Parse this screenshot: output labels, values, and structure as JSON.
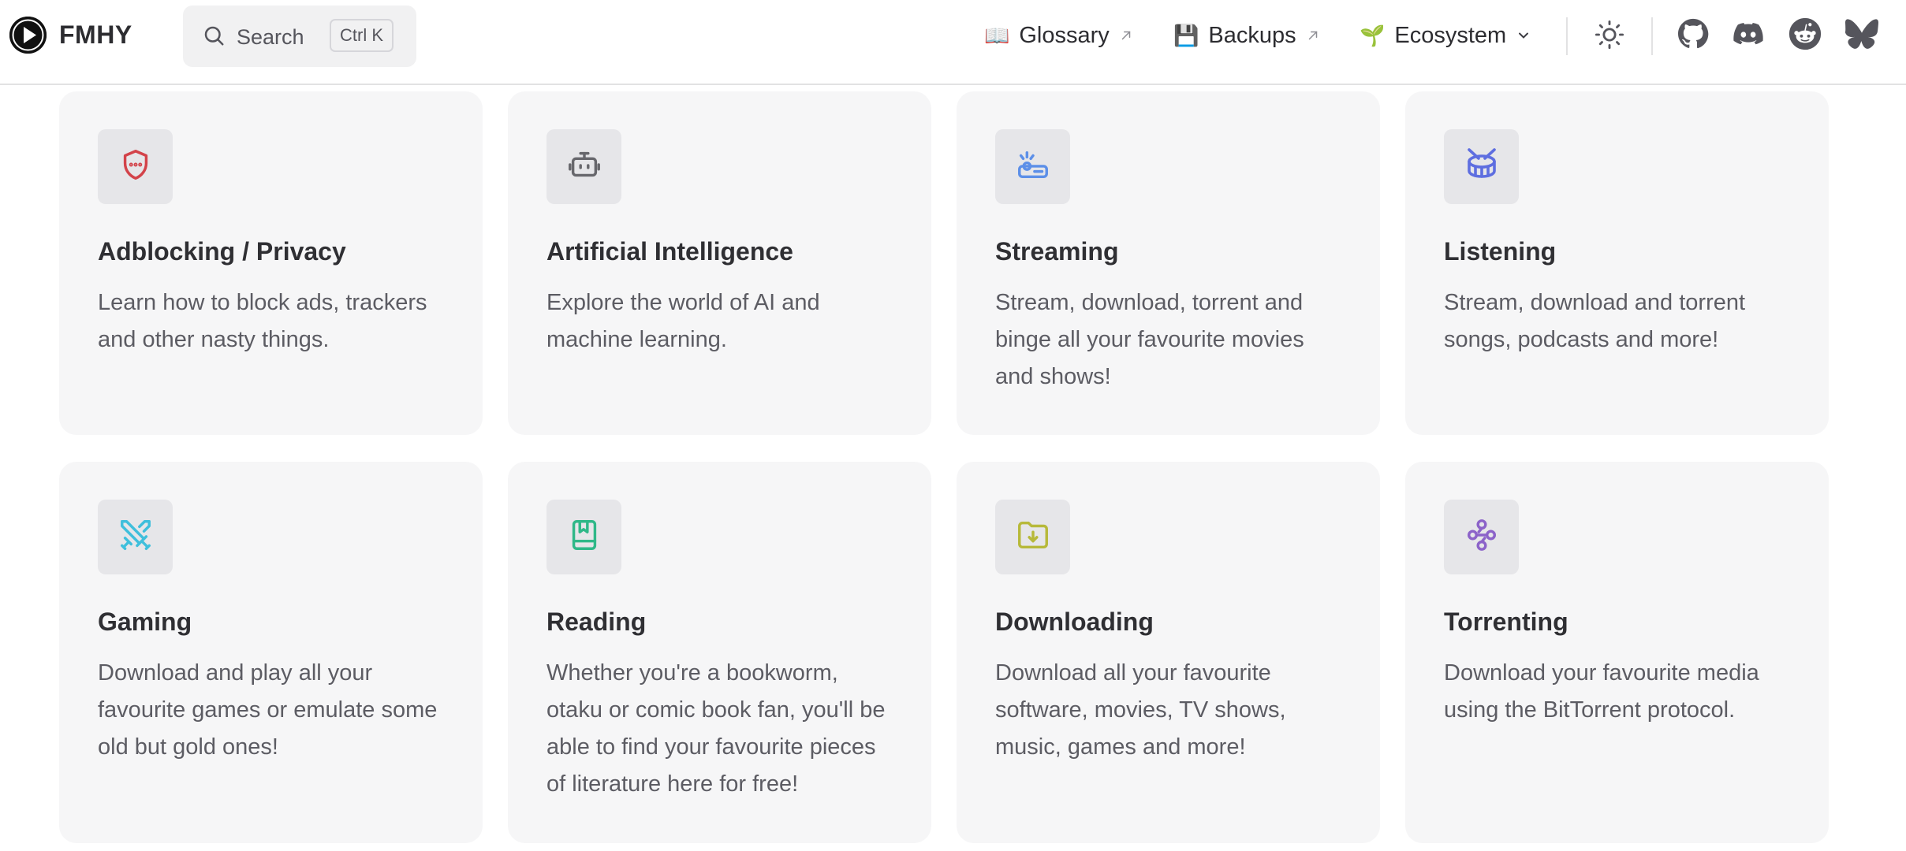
{
  "header": {
    "brand": "FMHY",
    "search": {
      "label": "Search",
      "shortcut": "Ctrl K"
    },
    "links": [
      {
        "emoji": "📖",
        "label": "Glossary",
        "external": true
      },
      {
        "emoji": "💾",
        "label": "Backups",
        "external": true
      },
      {
        "emoji": "🌱",
        "label": "Ecosystem",
        "dropdown": true
      }
    ],
    "social_icons": [
      "github-icon",
      "discord-icon",
      "reddit-icon",
      "bluesky-icon"
    ],
    "theme_icon": "sun-icon"
  },
  "cards": [
    {
      "title": "Adblocking / Privacy",
      "description": "Learn how to block ads, trackers and other nasty things.",
      "icon": "shield-icon",
      "color": "#d3434a"
    },
    {
      "title": "Artificial Intelligence",
      "description": "Explore the world of AI and machine learning.",
      "icon": "robot-icon",
      "color": "#67676c"
    },
    {
      "title": "Streaming",
      "description": "Stream, download, torrent and binge all your favourite movies and shows!",
      "icon": "router-icon",
      "color": "#5c8fe8"
    },
    {
      "title": "Listening",
      "description": "Stream, download and torrent songs, podcasts and more!",
      "icon": "drum-icon",
      "color": "#5e6ee0"
    },
    {
      "title": "Gaming",
      "description": "Download and play all your favourite games or emulate some old but gold ones!",
      "icon": "swords-icon",
      "color": "#3fbfdc"
    },
    {
      "title": "Reading",
      "description": "Whether you're a bookworm, otaku or comic book fan, you'll be able to find your favourite pieces of literature here for free!",
      "icon": "book-icon",
      "color": "#2fb888"
    },
    {
      "title": "Downloading",
      "description": "Download all your favourite software, movies, TV shows, music, games and more!",
      "icon": "folder-download-icon",
      "color": "#b7b93a"
    },
    {
      "title": "Torrenting",
      "description": "Download your favourite media using the BitTorrent protocol.",
      "icon": "network-icon",
      "color": "#8c63c9"
    }
  ]
}
